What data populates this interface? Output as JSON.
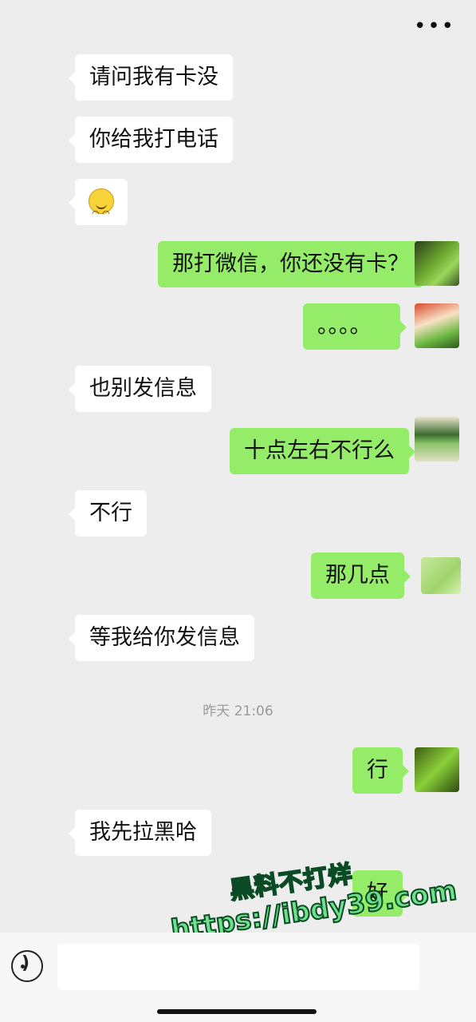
{
  "header": {
    "more_label": "•••"
  },
  "messages": {
    "m1": "请问我有卡没",
    "m2": "你给我打电话",
    "m4": "那打微信，你还没有卡？",
    "m5": "。。。。",
    "m6": "也别发信息",
    "m7": "十点左右不行么",
    "m8": "不行",
    "m9": "那几点",
    "m10": "等我给你发信息",
    "m11": "行",
    "m12": "我先拉黑哈",
    "m13": "好"
  },
  "timestamp": "昨天 21:06",
  "watermark": {
    "line1": "黑料不打烊",
    "line2": "https://ibdy39.com"
  },
  "input": {
    "placeholder": ""
  }
}
